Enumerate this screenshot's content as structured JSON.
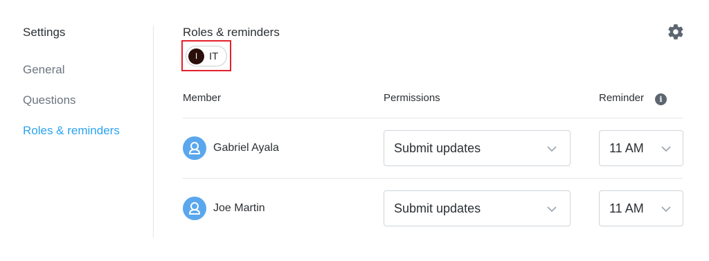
{
  "sidebar": {
    "title": "Settings",
    "items": [
      {
        "label": "General",
        "active": false
      },
      {
        "label": "Questions",
        "active": false
      },
      {
        "label": "Roles & reminders",
        "active": true
      }
    ]
  },
  "main": {
    "title": "Roles & reminders",
    "gear_icon": "gear-icon",
    "team_chip": {
      "initial": "I",
      "label": "IT"
    },
    "columns": {
      "member": "Member",
      "permissions": "Permissions",
      "reminder": "Reminder"
    },
    "info_icon": "info-icon",
    "rows": [
      {
        "name": "Gabriel Ayala",
        "permission": "Submit updates",
        "reminder": "11 AM"
      },
      {
        "name": "Joe Martin",
        "permission": "Submit updates",
        "reminder": "11 AM"
      }
    ]
  },
  "colors": {
    "accent": "#2aa3f0",
    "avatar": "#5aa7ee",
    "highlight": "#e2202b"
  }
}
